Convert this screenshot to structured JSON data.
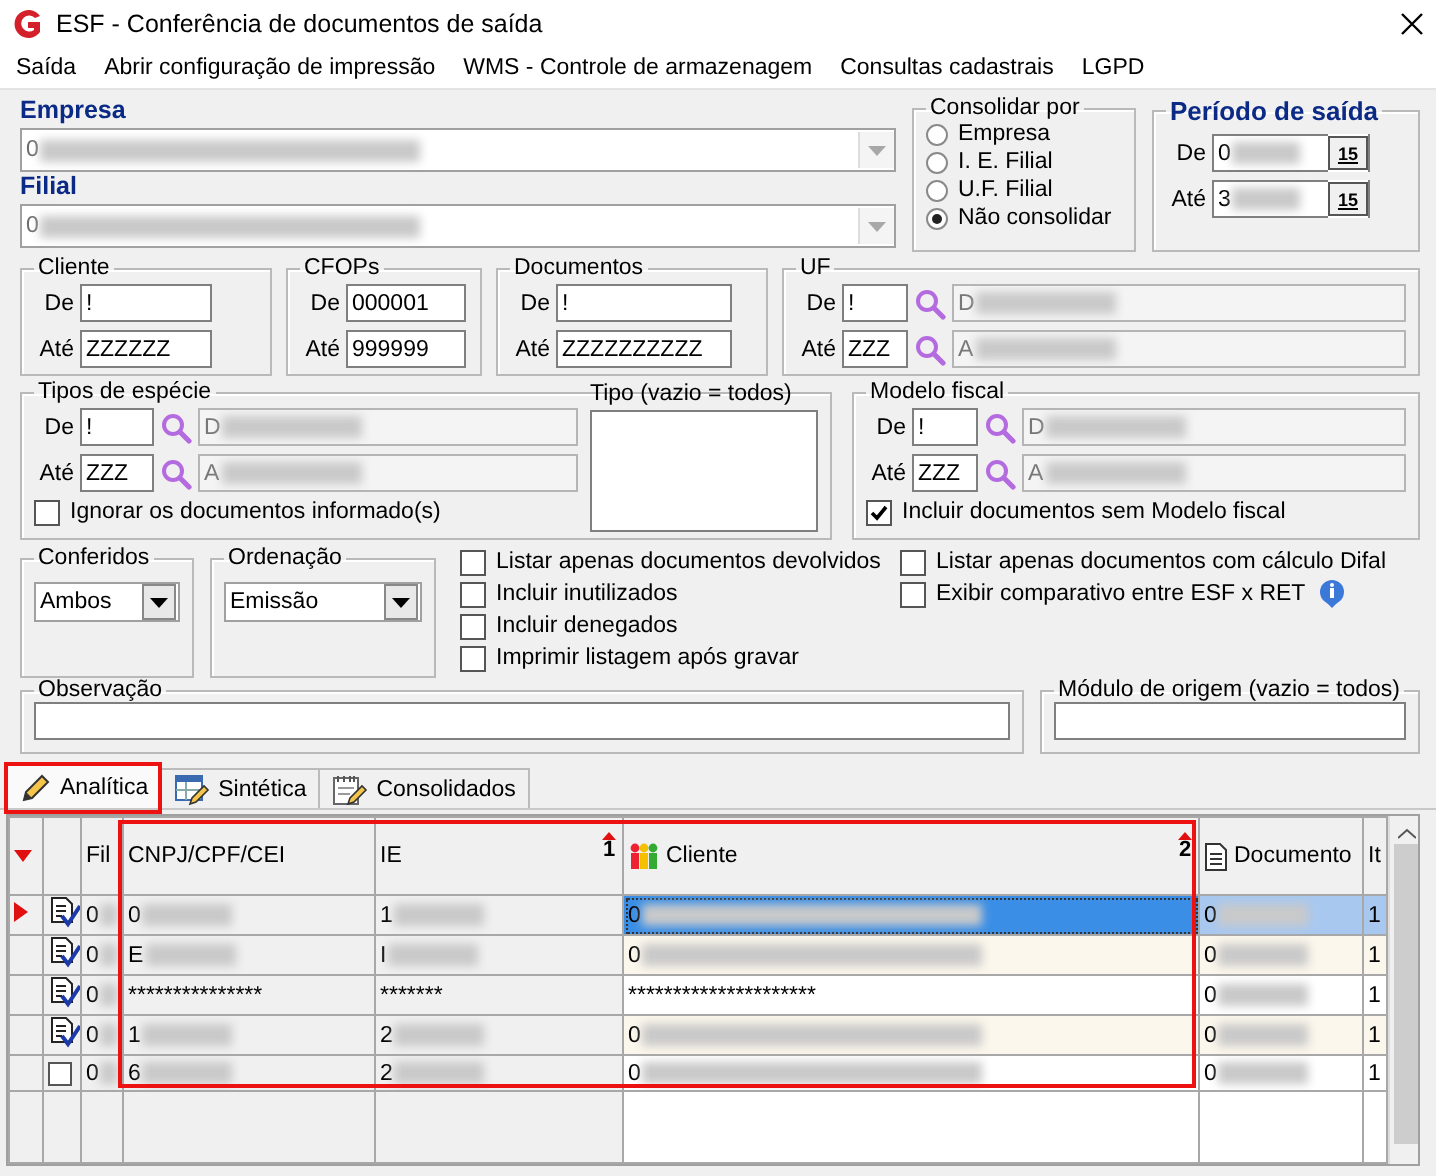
{
  "window": {
    "title": "ESF - Conferência de documentos de saída"
  },
  "menu": [
    "Saída",
    "Abrir configuração de impressão",
    "WMS - Controle de armazenagem",
    "Consultas cadastrais",
    "LGPD"
  ],
  "empresa": {
    "label": "Empresa",
    "value": "0",
    "redacted": true
  },
  "filial": {
    "label": "Filial",
    "value": "0",
    "redacted": true
  },
  "consolidar": {
    "title": "Consolidar por",
    "options": [
      {
        "label": "Empresa",
        "selected": false
      },
      {
        "label": "I. E. Filial",
        "selected": false
      },
      {
        "label": "U.F. Filial",
        "selected": false
      },
      {
        "label": "Não consolidar",
        "selected": true
      }
    ]
  },
  "periodo": {
    "title": "Período de saída",
    "rows": [
      {
        "label": "De",
        "value": "0",
        "redacted": true,
        "button": "15"
      },
      {
        "label": "Até",
        "value": "3",
        "redacted": true,
        "button": "15"
      }
    ]
  },
  "cliente": {
    "title": "Cliente",
    "rows": [
      {
        "label": "De",
        "value": "!"
      },
      {
        "label": "Até",
        "value": "ZZZZZZ"
      }
    ]
  },
  "cfops": {
    "title": "CFOPs",
    "rows": [
      {
        "label": "De",
        "value": "000001"
      },
      {
        "label": "Até",
        "value": "999999"
      }
    ]
  },
  "documentos": {
    "title": "Documentos",
    "rows": [
      {
        "label": "De",
        "value": "!"
      },
      {
        "label": "Até",
        "value": "ZZZZZZZZZZ"
      }
    ]
  },
  "uf": {
    "title": "UF",
    "rows": [
      {
        "label": "De",
        "value": "!",
        "description": "D",
        "redacted": true
      },
      {
        "label": "Até",
        "value": "ZZZ",
        "description": "A",
        "redacted": true
      }
    ]
  },
  "tipos_especie": {
    "title": "Tipos de espécie",
    "rows": [
      {
        "label": "De",
        "value": "!",
        "description": "D",
        "redacted": true
      },
      {
        "label": "Até",
        "value": "ZZZ",
        "description": "A",
        "redacted": true
      }
    ],
    "checkbox": {
      "label": "Ignorar os documentos informado(s)",
      "checked": false
    },
    "tipo": {
      "title": "Tipo (vazio = todos)"
    }
  },
  "modelo_fiscal": {
    "title": "Modelo fiscal",
    "rows": [
      {
        "label": "De",
        "value": "!",
        "description": "D",
        "redacted": true
      },
      {
        "label": "Até",
        "value": "ZZZ",
        "description": "A",
        "redacted": true
      }
    ],
    "checkbox": {
      "label": "Incluir documentos sem Modelo fiscal",
      "checked": true
    }
  },
  "conferidos": {
    "title": "Conferidos",
    "value": "Ambos"
  },
  "ordenacao": {
    "title": "Ordenação",
    "value": "Emissão"
  },
  "options_left": [
    {
      "label": "Listar apenas documentos devolvidos",
      "checked": false
    },
    {
      "label": "Incluir inutilizados",
      "checked": false
    },
    {
      "label": "Incluir denegados",
      "checked": false
    },
    {
      "label": "Imprimir listagem após gravar",
      "checked": false
    }
  ],
  "options_right": [
    {
      "label": "Listar apenas documentos com cálculo Difal",
      "checked": false,
      "info": false
    },
    {
      "label": "Exibir comparativo entre ESF x  RET",
      "checked": false,
      "info": true
    }
  ],
  "observacao": {
    "title": "Observação"
  },
  "modulo": {
    "title": "Módulo de origem (vazio = todos)"
  },
  "tabs": [
    {
      "label": "Analítica",
      "selected": true
    },
    {
      "label": "Sintética",
      "selected": false
    },
    {
      "label": "Consolidados",
      "selected": false
    }
  ],
  "grid": {
    "columns": [
      {
        "label": "Fil"
      },
      {
        "label": "CNPJ/CPF/CEI"
      },
      {
        "label": "IE",
        "sort": "1"
      },
      {
        "label": "Cliente",
        "sort": "2"
      },
      {
        "label": "Documento"
      },
      {
        "label": "It"
      }
    ],
    "rows": [
      {
        "kind": "document",
        "selected": true,
        "cells": [
          {
            "text": "0",
            "redacted": true
          },
          {
            "text": "0",
            "redacted": true
          },
          {
            "text": "1",
            "redacted": true
          },
          {
            "text": "0",
            "redacted": true
          },
          {
            "text": "0",
            "redacted": true
          },
          {
            "text": "1"
          }
        ]
      },
      {
        "kind": "document",
        "selected": false,
        "cells": [
          {
            "text": "0",
            "redacted": true
          },
          {
            "text": "E",
            "redacted": true
          },
          {
            "text": "I",
            "redacted": true
          },
          {
            "text": "0",
            "redacted": true
          },
          {
            "text": "0",
            "redacted": true
          },
          {
            "text": "1"
          }
        ]
      },
      {
        "kind": "document",
        "selected": false,
        "cells": [
          {
            "text": "0",
            "redacted": true
          },
          {
            "text": "***************"
          },
          {
            "text": "*******"
          },
          {
            "text": "*********************"
          },
          {
            "text": "0",
            "redacted": true
          },
          {
            "text": "1"
          }
        ]
      },
      {
        "kind": "document",
        "selected": false,
        "cells": [
          {
            "text": "0",
            "redacted": true
          },
          {
            "text": "1",
            "redacted": true
          },
          {
            "text": "2",
            "redacted": true
          },
          {
            "text": "0",
            "redacted": true
          },
          {
            "text": "0",
            "redacted": true
          },
          {
            "text": "1"
          }
        ]
      },
      {
        "kind": "checkbox",
        "selected": false,
        "checked": false,
        "cells": [
          {
            "text": "0",
            "redacted": true
          },
          {
            "text": "6",
            "redacted": true
          },
          {
            "text": "2",
            "redacted": true
          },
          {
            "text": "0",
            "redacted": true
          },
          {
            "text": "0",
            "redacted": true
          },
          {
            "text": "1"
          }
        ]
      }
    ]
  }
}
